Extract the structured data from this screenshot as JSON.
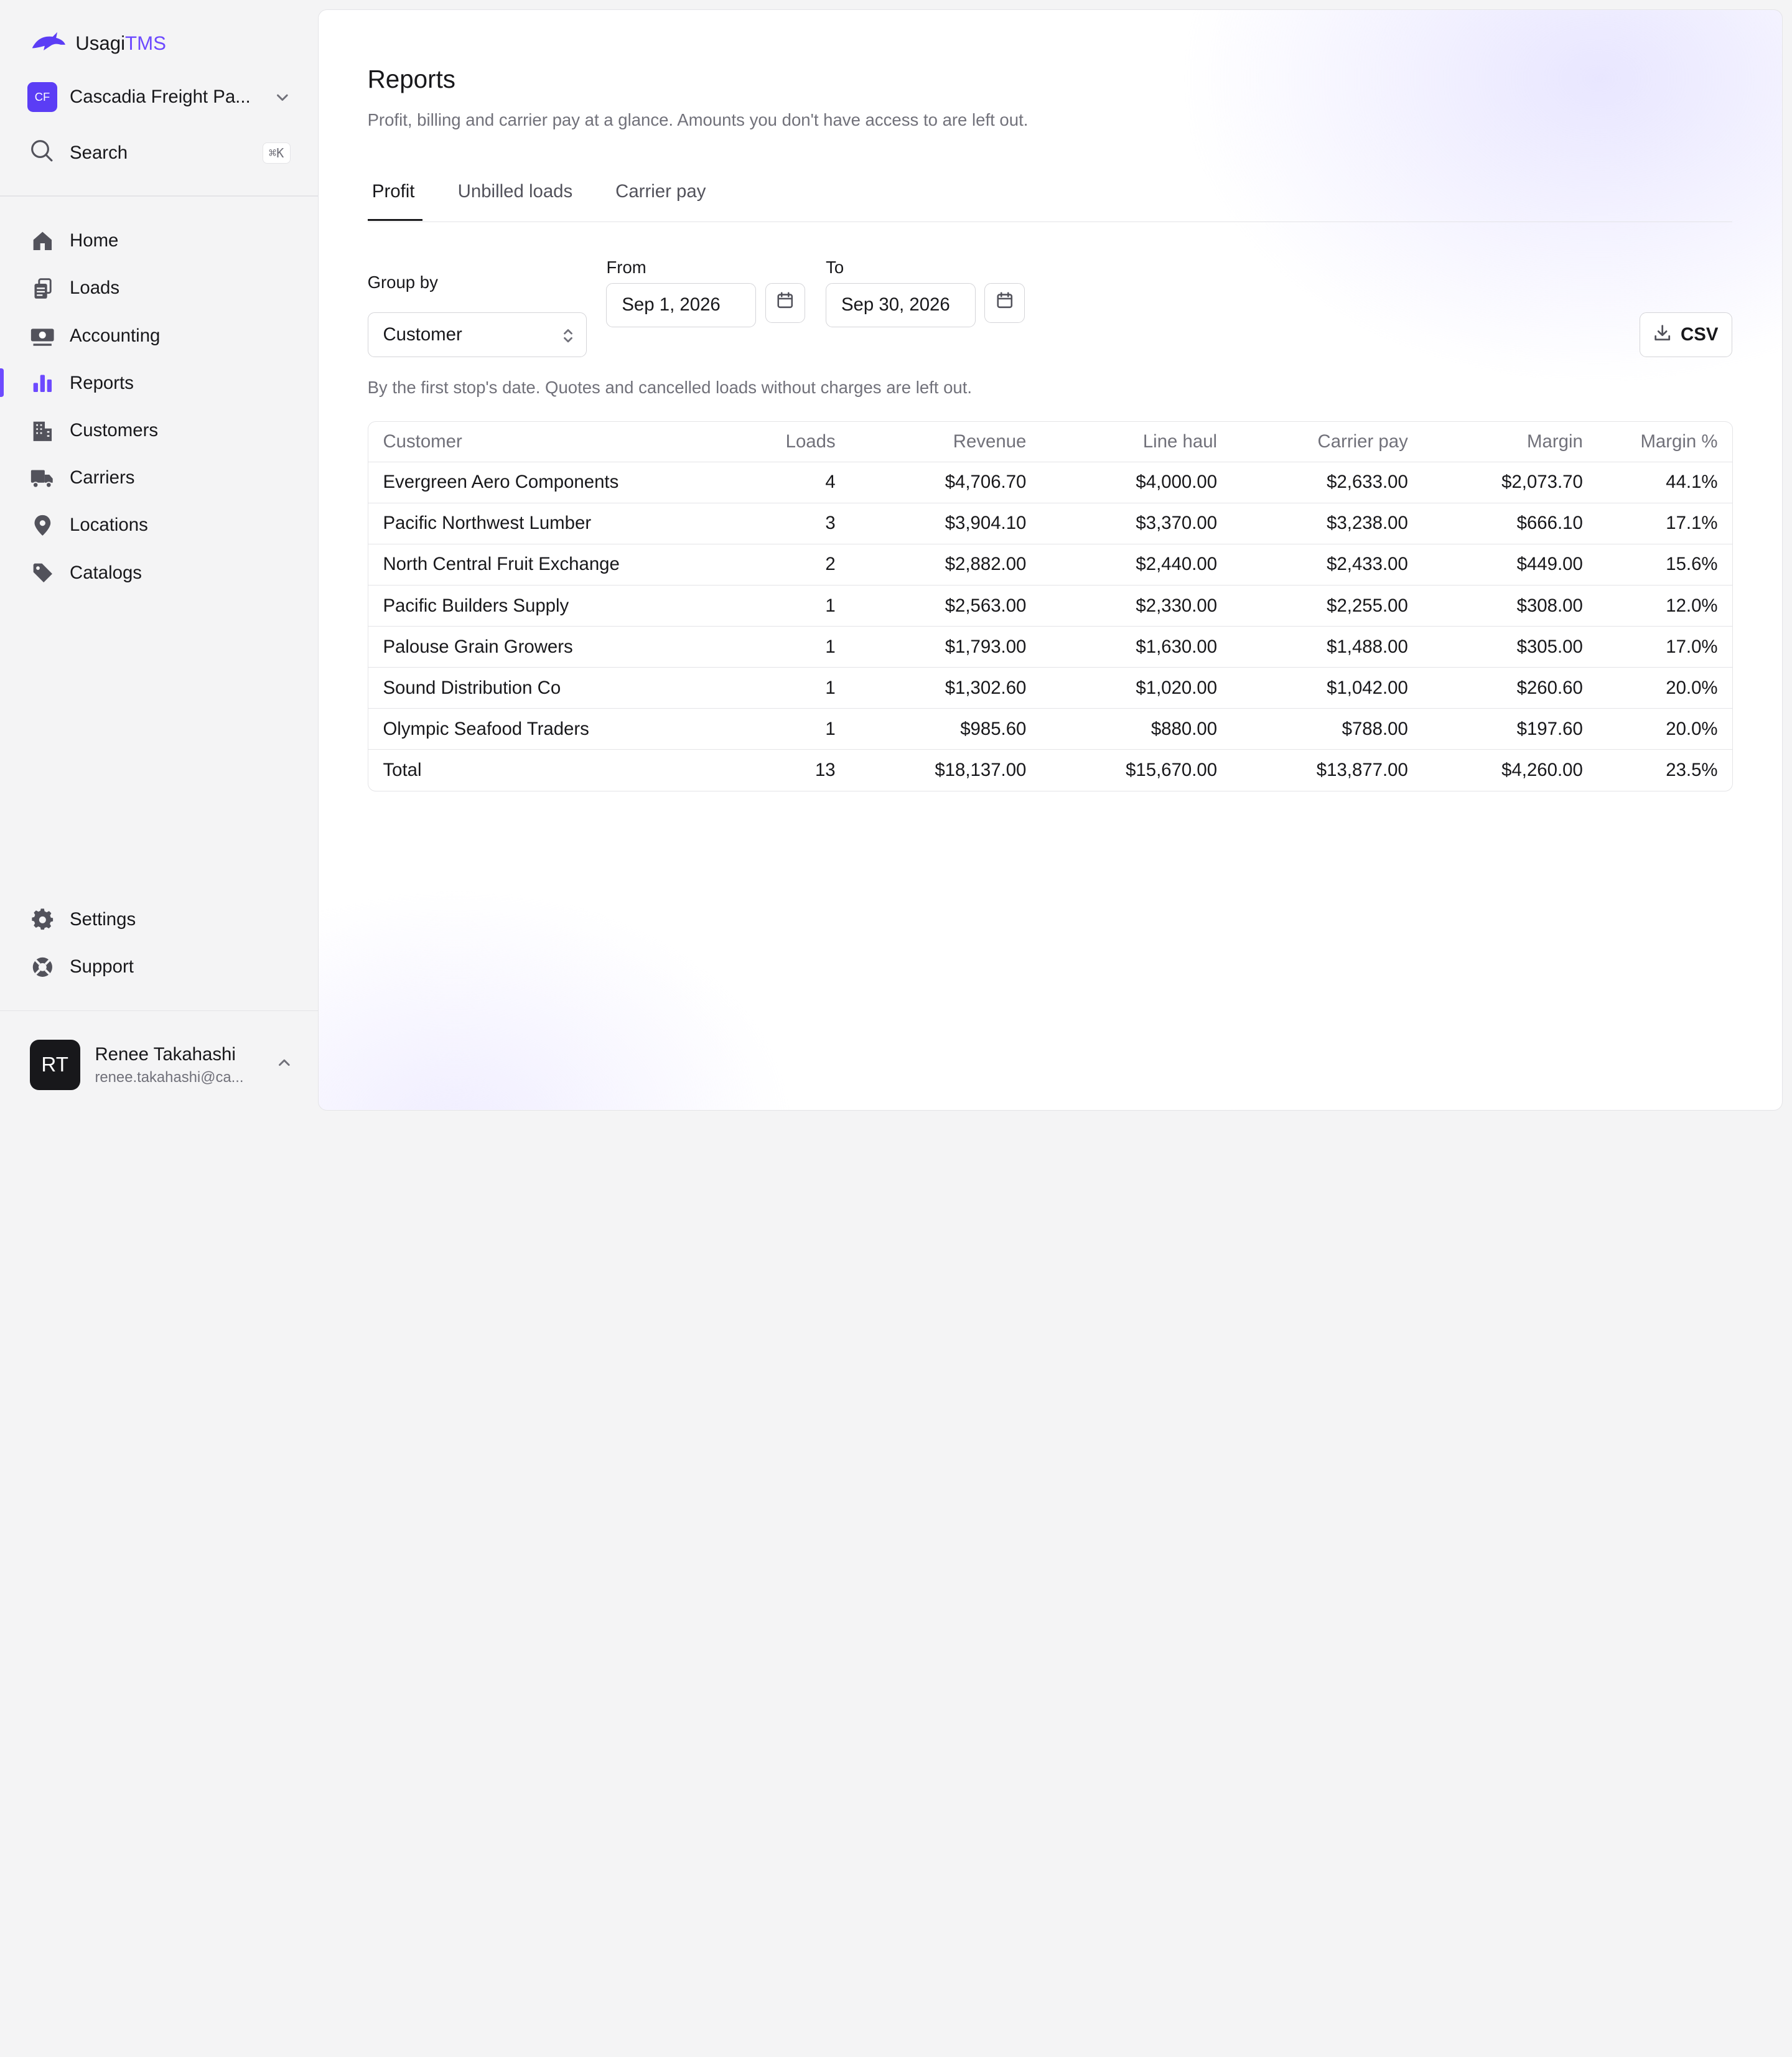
{
  "brand": {
    "name_primary": "Usagi",
    "name_accent": "TMS"
  },
  "org": {
    "initials": "CF",
    "name": "Cascadia Freight Pa..."
  },
  "search": {
    "label": "Search",
    "shortcut": "⌘K"
  },
  "nav": {
    "items": [
      {
        "label": "Home",
        "icon": "home-icon"
      },
      {
        "label": "Loads",
        "icon": "loads-icon"
      },
      {
        "label": "Accounting",
        "icon": "accounting-icon"
      },
      {
        "label": "Reports",
        "icon": "reports-icon"
      },
      {
        "label": "Customers",
        "icon": "customers-icon"
      },
      {
        "label": "Carriers",
        "icon": "carriers-icon"
      },
      {
        "label": "Locations",
        "icon": "location-icon"
      },
      {
        "label": "Catalogs",
        "icon": "tag-icon"
      }
    ],
    "bottom": [
      {
        "label": "Settings",
        "icon": "gear-icon"
      },
      {
        "label": "Support",
        "icon": "support-icon"
      }
    ]
  },
  "user": {
    "initials": "RT",
    "name": "Renee Takahashi",
    "email": "renee.takahashi@ca..."
  },
  "page": {
    "title": "Reports",
    "subtitle": "Profit, billing and carrier pay at a glance. Amounts you don't have access to are left out."
  },
  "tabs": [
    {
      "label": "Profit",
      "active": true
    },
    {
      "label": "Unbilled loads",
      "active": false
    },
    {
      "label": "Carrier pay",
      "active": false
    }
  ],
  "filters": {
    "group_by_label": "Group by",
    "group_by_value": "Customer",
    "from_label": "From",
    "from_value": "Sep 1, 2026",
    "to_label": "To",
    "to_value": "Sep 30, 2026",
    "csv_label": "CSV"
  },
  "note": "By the first stop's date. Quotes and cancelled loads without charges are left out.",
  "table": {
    "columns": [
      "Customer",
      "Loads",
      "Revenue",
      "Line haul",
      "Carrier pay",
      "Margin",
      "Margin %"
    ],
    "rows": [
      [
        "Evergreen Aero Components",
        "4",
        "$4,706.70",
        "$4,000.00",
        "$2,633.00",
        "$2,073.70",
        "44.1%"
      ],
      [
        "Pacific Northwest Lumber",
        "3",
        "$3,904.10",
        "$3,370.00",
        "$3,238.00",
        "$666.10",
        "17.1%"
      ],
      [
        "North Central Fruit Exchange",
        "2",
        "$2,882.00",
        "$2,440.00",
        "$2,433.00",
        "$449.00",
        "15.6%"
      ],
      [
        "Pacific Builders Supply",
        "1",
        "$2,563.00",
        "$2,330.00",
        "$2,255.00",
        "$308.00",
        "12.0%"
      ],
      [
        "Palouse Grain Growers",
        "1",
        "$1,793.00",
        "$1,630.00",
        "$1,488.00",
        "$305.00",
        "17.0%"
      ],
      [
        "Sound Distribution Co",
        "1",
        "$1,302.60",
        "$1,020.00",
        "$1,042.00",
        "$260.60",
        "20.0%"
      ],
      [
        "Olympic Seafood Traders",
        "1",
        "$985.60",
        "$880.00",
        "$788.00",
        "$197.60",
        "20.0%"
      ]
    ],
    "total": [
      "Total",
      "13",
      "$18,137.00",
      "$15,670.00",
      "$13,877.00",
      "$4,260.00",
      "23.5%"
    ]
  },
  "colors": {
    "accent": "#6d4aff",
    "org_badge": "#5b3df5",
    "text": "#18181b",
    "muted": "#71717a",
    "border": "#e4e4e7"
  }
}
